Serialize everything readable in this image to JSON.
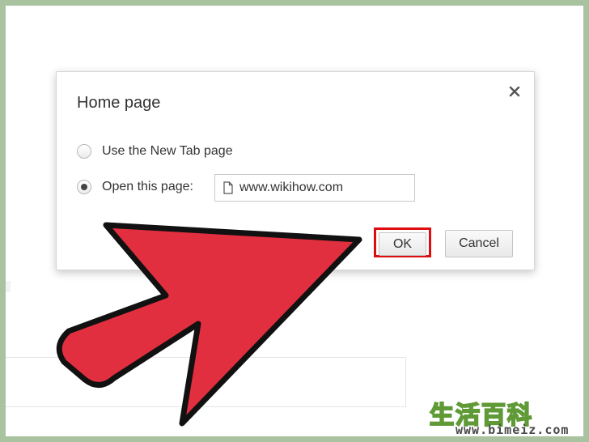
{
  "dialog": {
    "title": "Home page",
    "close_icon": "close-icon",
    "options": [
      {
        "label": "Use the New Tab page",
        "checked": false
      },
      {
        "label": "Open this page:",
        "checked": true
      }
    ],
    "url_field": {
      "value": "www.wikihow.com",
      "icon": "page-icon"
    },
    "buttons": {
      "ok_label": "OK",
      "cancel_label": "Cancel"
    }
  },
  "annotation": {
    "highlight_color": "#dd0d10",
    "arrow_color": "#e12f3f"
  },
  "watermark": {
    "chars": "生活百科",
    "url": "www.bimeiz.com"
  }
}
